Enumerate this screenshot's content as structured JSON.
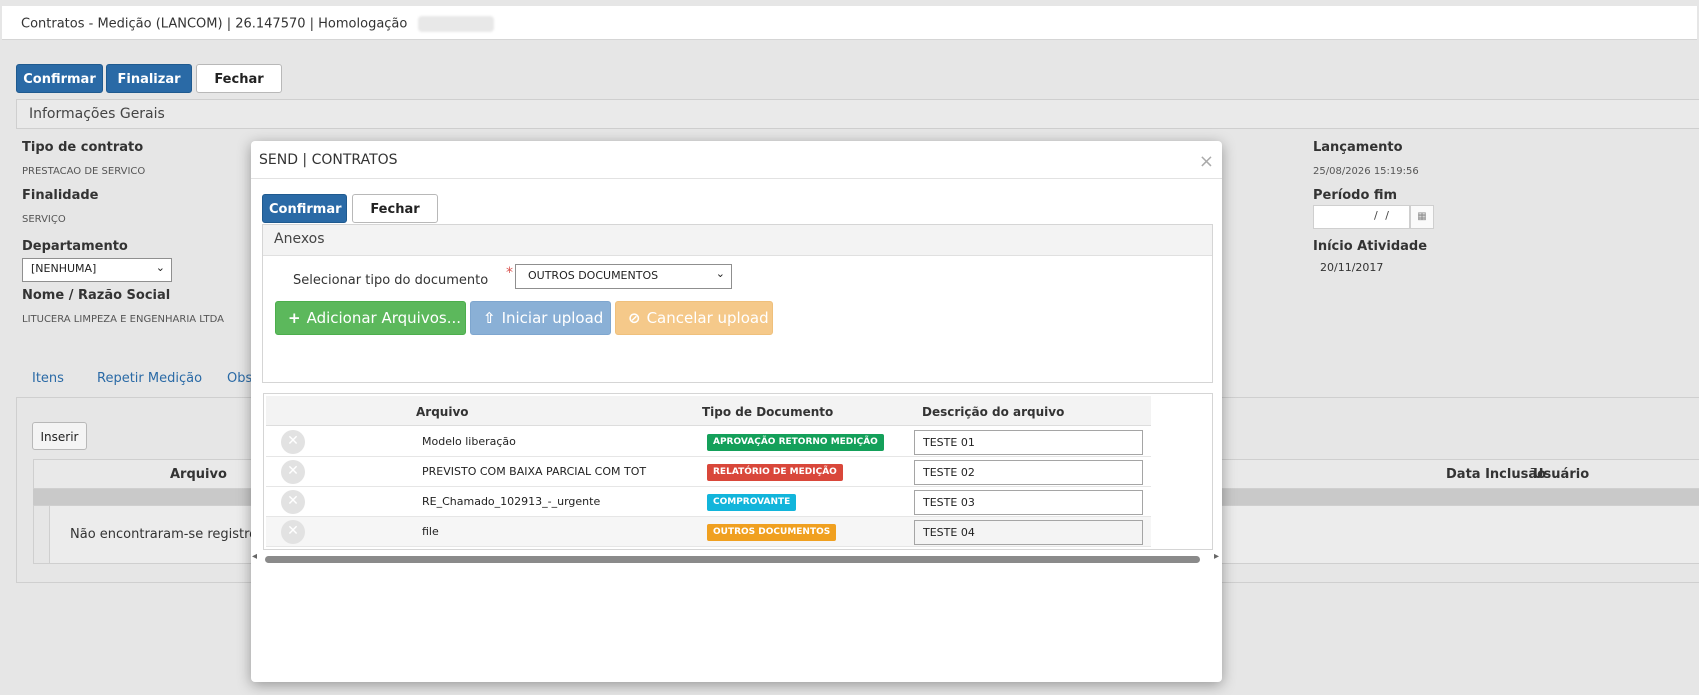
{
  "header": {
    "title": "Contratos - Medição (LANCOM) | 26.147570 | Homologação"
  },
  "toolbar": {
    "confirm": "Confirmar",
    "finalize": "Finalizar",
    "close": "Fechar"
  },
  "general_panel": {
    "title": "Informações Gerais",
    "tipo_contrato_label": "Tipo de contrato",
    "tipo_contrato_value": "PRESTACAO DE SERVICO",
    "finalidade_label": "Finalidade",
    "finalidade_value": "SERVIÇO",
    "departamento_label": "Departamento",
    "departamento_value": "[NENHUMA]",
    "nome_label": "Nome / Razão Social",
    "nome_value": "LITUCERA LIMPEZA E ENGENHARIA LTDA",
    "lancamento_label": "Lançamento",
    "lancamento_value": "25/08/2026 15:19:56",
    "periodo_fim_label": "Período fim",
    "periodo_fim_value": "/ /",
    "inicio_atividade_label": "Início Atividade",
    "inicio_atividade_value": "20/11/2017"
  },
  "tabs": [
    "Itens",
    "Repetir Medição",
    "Obse"
  ],
  "lower": {
    "insert_button": "Inserir",
    "col_arquivo": "Arquivo",
    "col_data_inclusao": "Data Inclusão",
    "col_usuario": "Usuário",
    "empty_message": "Não encontraram-se registros"
  },
  "modal": {
    "title": "SEND | CONTRATOS",
    "close_glyph": "×",
    "confirm": "Confirmar",
    "close": "Fechar",
    "anexos_title": "Anexos",
    "doc_type_label": "Selecionar tipo do documento",
    "required_mark": "*",
    "doc_type_selected": "OUTROS DOCUMENTOS",
    "add_files": "Adicionar Arquivos...",
    "start_upload": "Iniciar upload",
    "cancel_upload": "Cancelar upload",
    "columns": {
      "arquivo": "Arquivo",
      "tipo": "Tipo de Documento",
      "descricao": "Descrição do arquivo"
    },
    "files": [
      {
        "name": "Modelo liberação",
        "type": "APROVAÇÃO RETORNO MEDIÇÃO",
        "type_color": "#14a05a",
        "description": "TESTE 01"
      },
      {
        "name": "PREVISTO COM BAIXA PARCIAL COM TOT",
        "type": "RELATÓRIO DE MEDIÇÃO",
        "type_color": "#d9473a",
        "description": "TESTE 02"
      },
      {
        "name": "RE_Chamado_102913_-_urgente",
        "type": "COMPROVANTE",
        "type_color": "#12b5db",
        "description": "TESTE 03"
      },
      {
        "name": "file",
        "type": "OUTROS DOCUMENTOS",
        "type_color": "#f0a020",
        "description": "TESTE 04"
      }
    ]
  },
  "colors": {
    "primary": "#2a6aa6",
    "success": "#5cb85c",
    "info": "#8ab0d6",
    "warning": "#f5c98a"
  }
}
